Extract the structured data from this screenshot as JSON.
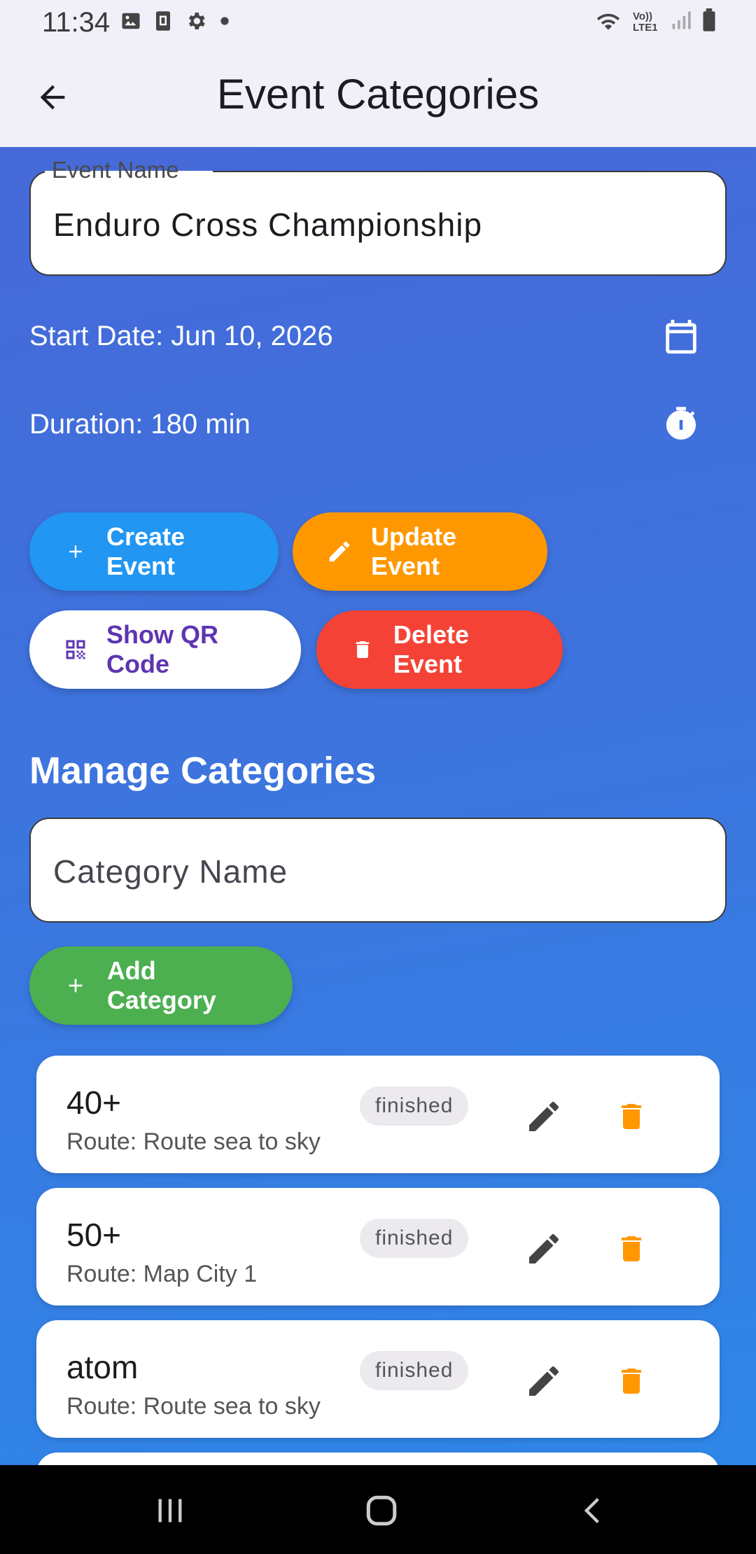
{
  "status_bar": {
    "time": "11:34",
    "left_icons": [
      "image-icon",
      "sim-icon",
      "gear-icon",
      "dot-icon"
    ],
    "right_icons": [
      "wifi-icon",
      "volte-icon",
      "signal-icon",
      "battery-icon"
    ],
    "volte_text": "Vo)) LTE1"
  },
  "app_bar": {
    "title": "Event Categories"
  },
  "event_form": {
    "name_label": "Event Name",
    "name_value": "Enduro Cross Championship",
    "start_date": "Start Date: Jun 10, 2026",
    "duration": "Duration: 180 min"
  },
  "buttons": {
    "create": "Create Event",
    "update": "Update Event",
    "qr": "Show QR Code",
    "delete": "Delete Event",
    "add_category": "Add Category"
  },
  "categories_section": {
    "title": "Manage Categories",
    "input_placeholder": "Category Name",
    "items": [
      {
        "name": "40+",
        "route": "Route: Route sea to sky",
        "status": "finished"
      },
      {
        "name": "50+",
        "route": "Route: Map City 1",
        "status": "finished"
      },
      {
        "name": "atom",
        "route": "Route: Route sea to sky",
        "status": "finished"
      }
    ]
  },
  "colors": {
    "create": "#2196f3",
    "update": "#ff9800",
    "delete": "#f44336",
    "add": "#4caf50",
    "qr_text": "#5e35b1",
    "trash": "#ff9800"
  }
}
